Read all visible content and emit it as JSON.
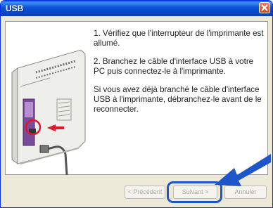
{
  "window": {
    "title": "USB"
  },
  "instructions": {
    "step1": "1. Vérifiez que l'interrupteur de l'imprimante est allumé.",
    "step2": "2. Branchez le câble d'interface USB à votre PC puis connectez-le à l'imprimante.",
    "note": "Si vous avez déjà branché le câble d'interface USB à l'imprimante, débranchez-le avant de le reconnecter."
  },
  "buttons": {
    "prev": "< Précédent",
    "next": "Suivant >",
    "cancel": "Annuler"
  },
  "colors": {
    "titlebar": "#0a53d6",
    "highlight": "#1c56c8",
    "arrow": "#1c56c8",
    "marker": "#e0182c"
  },
  "icons": [
    "close-icon",
    "printer-illustration",
    "usb-cable",
    "pointer-arrow-icon"
  ]
}
